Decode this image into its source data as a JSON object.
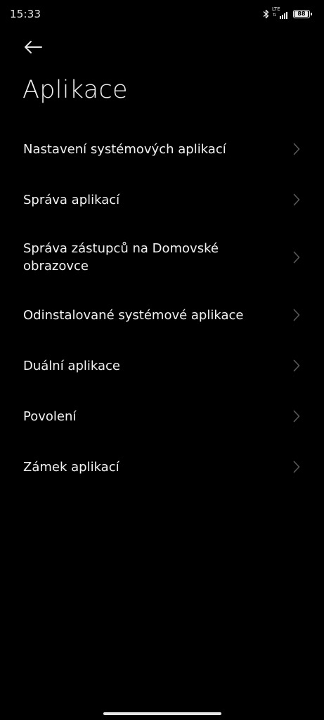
{
  "status_bar": {
    "time": "15:33",
    "network": "LTE",
    "battery_level": "88"
  },
  "header": {
    "title": "Aplikace"
  },
  "menu": {
    "items": [
      {
        "label": "Nastavení systémových aplikací"
      },
      {
        "label": "Správa aplikací"
      },
      {
        "label": "Správa zástupců na Domovské obrazovce"
      },
      {
        "label": "Odinstalované systémové aplikace"
      },
      {
        "label": "Duální aplikace"
      },
      {
        "label": "Povolení"
      },
      {
        "label": "Zámek aplikací"
      }
    ]
  },
  "colors": {
    "background": "#000000",
    "text": "#f2f2f2",
    "chevron": "#5a5a5a"
  }
}
